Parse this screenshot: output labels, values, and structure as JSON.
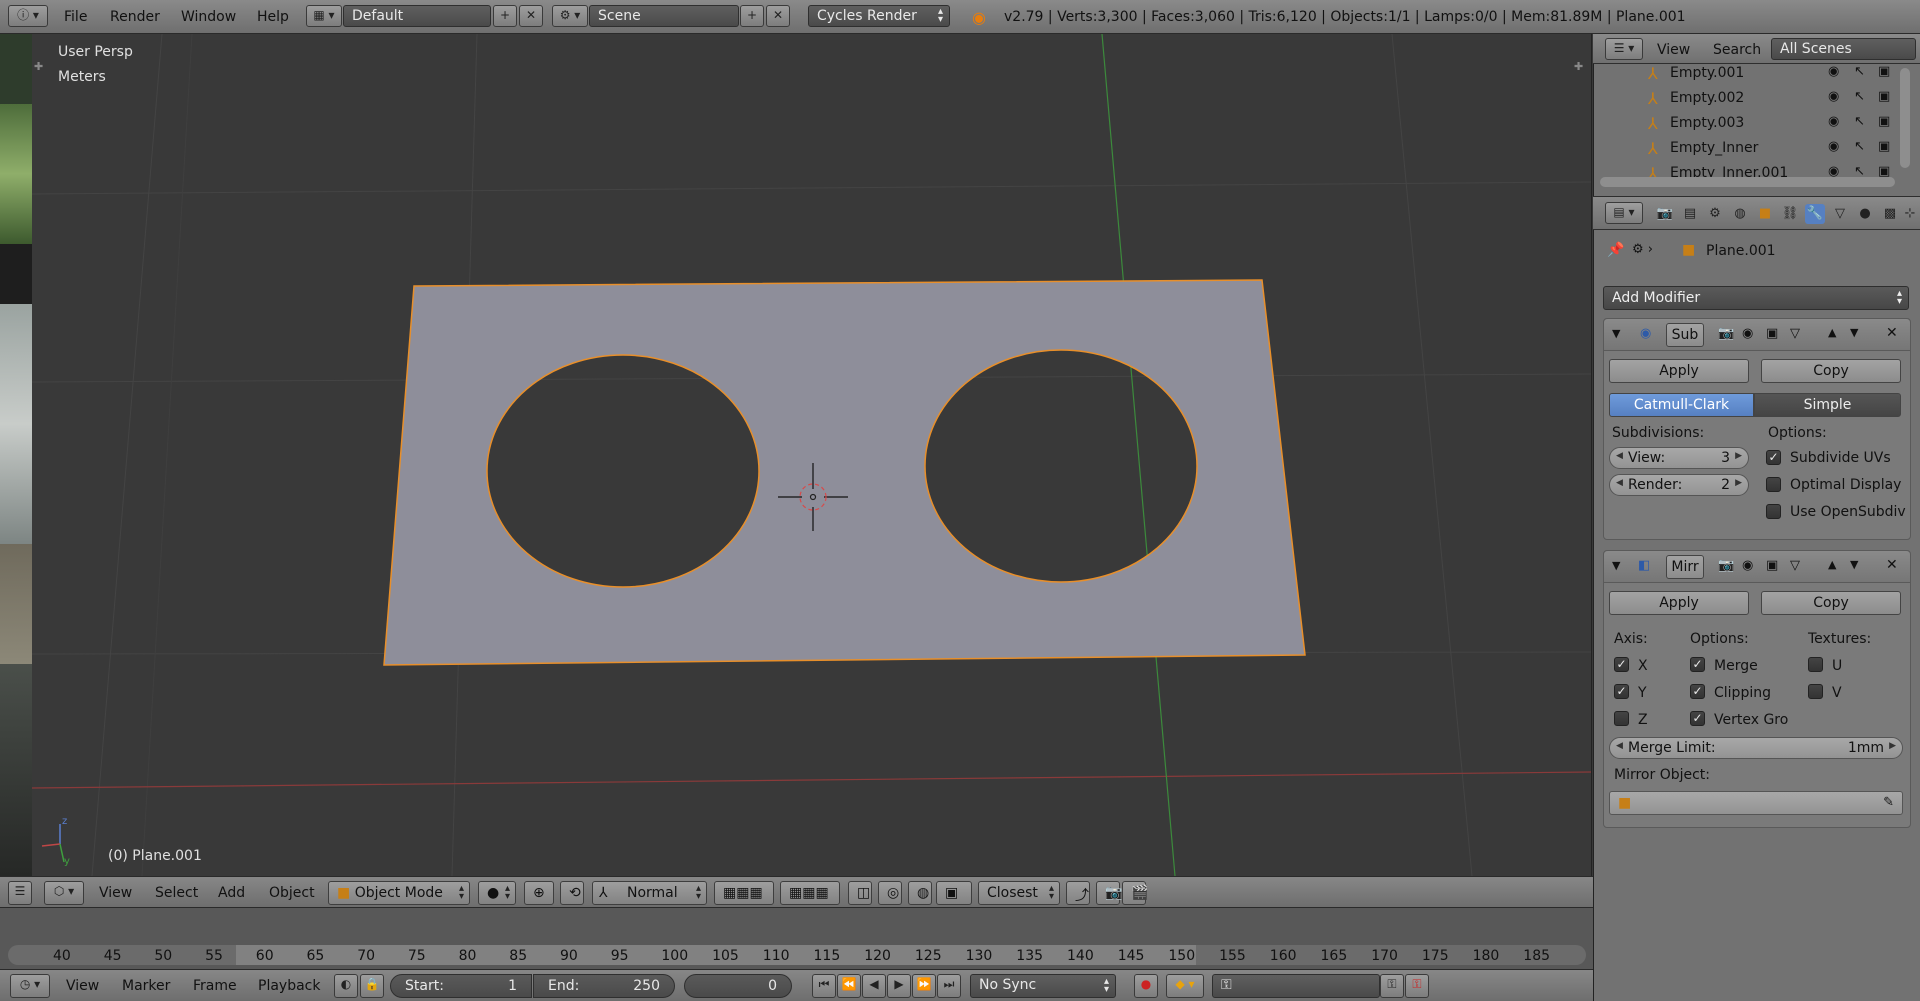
{
  "top": {
    "menus": [
      "File",
      "Render",
      "Window",
      "Help"
    ],
    "layout": "Default",
    "scene": "Scene",
    "engine": "Cycles Render",
    "stats": "v2.79 | Verts:3,300 | Faces:3,060 | Tris:6,120 | Objects:1/1 | Lamps:0/0 | Mem:81.89M | Plane.001"
  },
  "viewport": {
    "view_name": "User Persp",
    "units": "Meters",
    "object_label": "(0) Plane.001",
    "axis_z": "z",
    "axis_y": "y"
  },
  "vp_header": {
    "menus": [
      "View",
      "Select",
      "Add",
      "Object"
    ],
    "mode": "Object Mode",
    "orientation": "Normal",
    "snap_target": "Closest"
  },
  "timeline": {
    "ticks": [
      "40",
      "45",
      "50",
      "55",
      "60",
      "65",
      "70",
      "75",
      "80",
      "85",
      "90",
      "95",
      "100",
      "105",
      "110",
      "115",
      "120",
      "125",
      "130",
      "135",
      "140",
      "145",
      "150",
      "155",
      "160",
      "165",
      "170",
      "175",
      "180",
      "185"
    ],
    "menus": [
      "View",
      "Marker",
      "Frame",
      "Playback"
    ],
    "start_label": "Start:",
    "start": "1",
    "end_label": "End:",
    "end": "250",
    "current": "0",
    "sync": "No Sync"
  },
  "outliner": {
    "menus": [
      "View",
      "Search"
    ],
    "filter": "All Scenes",
    "items": [
      "Empty.001",
      "Empty.002",
      "Empty.003",
      "Empty_Inner",
      "Empty_Inner.001"
    ]
  },
  "properties": {
    "object": "Plane.001",
    "add_modifier": "Add Modifier",
    "subsurf": {
      "name": "Sub",
      "apply": "Apply",
      "copy": "Copy",
      "type_active": "Catmull-Clark",
      "type_other": "Simple",
      "subdivisions_label": "Subdivisions:",
      "options_label": "Options:",
      "view_label": "View:",
      "view_value": "3",
      "render_label": "Render:",
      "render_value": "2",
      "opt1": "Subdivide UVs",
      "opt2": "Optimal Display",
      "opt3": "Use OpenSubdiv"
    },
    "mirror": {
      "name": "Mirr",
      "apply": "Apply",
      "copy": "Copy",
      "axis_label": "Axis:",
      "options_label": "Options:",
      "textures_label": "Textures:",
      "x": "X",
      "y": "Y",
      "z": "Z",
      "merge": "Merge",
      "clipping": "Clipping",
      "vertex": "Vertex Gro",
      "u": "U",
      "v": "V",
      "merge_limit_label": "Merge Limit:",
      "merge_limit_value": "1mm",
      "mirror_object_label": "Mirror Object:"
    }
  },
  "colors": {
    "selection": "#e88f2a",
    "plane": "#8e8e9a",
    "active": "#5680c2"
  }
}
